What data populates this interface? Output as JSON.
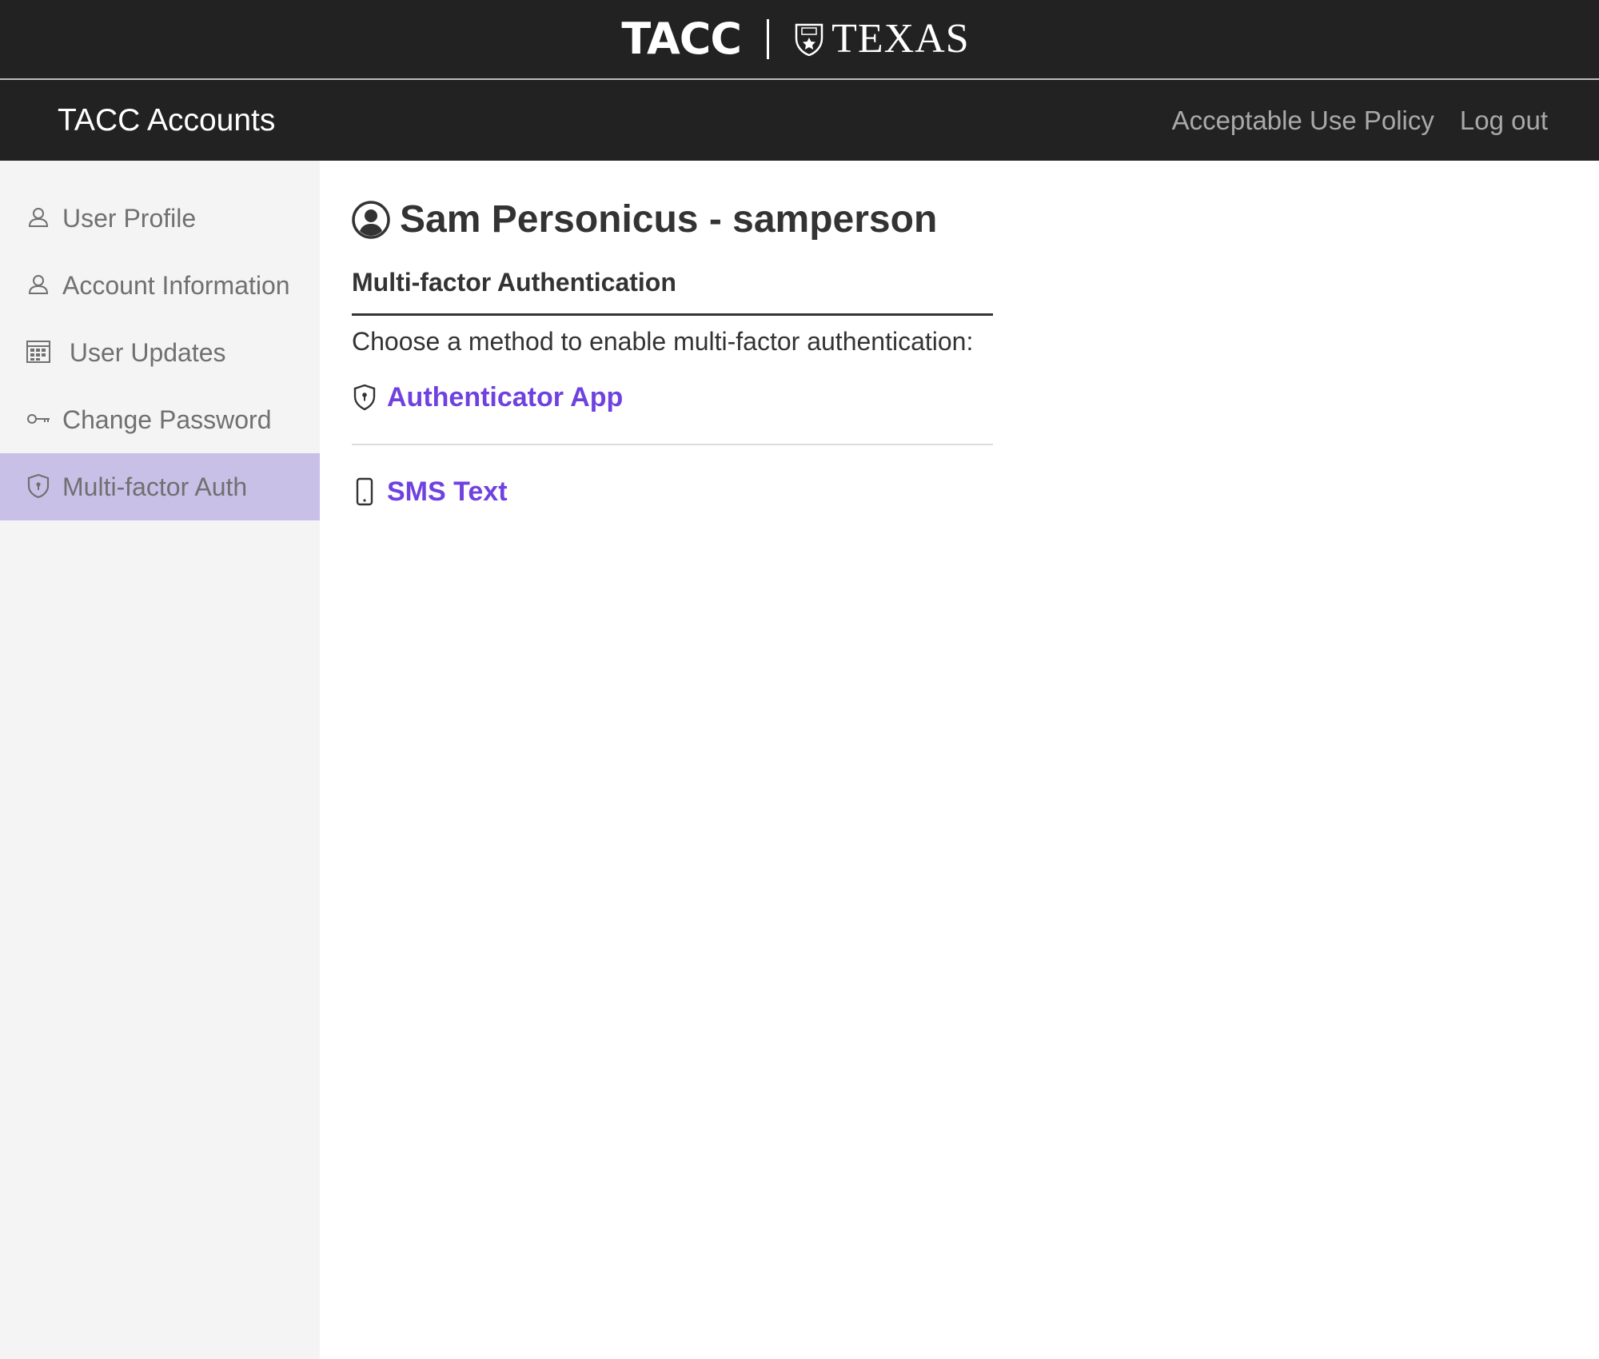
{
  "brand": {
    "tacc_logo": "TACC",
    "texas_logo": "TEXAS"
  },
  "nav": {
    "app_title": "TACC Accounts",
    "links": [
      {
        "label": "Acceptable Use Policy"
      },
      {
        "label": "Log out"
      }
    ]
  },
  "sidebar": {
    "items": [
      {
        "label": "User Profile",
        "icon": "person-icon",
        "active": false
      },
      {
        "label": "Account Information",
        "icon": "person-icon",
        "active": false
      },
      {
        "label": "User Updates",
        "icon": "calendar-icon",
        "active": false
      },
      {
        "label": "Change Password",
        "icon": "key-icon",
        "active": false
      },
      {
        "label": "Multi-factor Auth",
        "icon": "shield-icon",
        "active": true
      }
    ]
  },
  "main": {
    "user_heading": "Sam Personicus - samperson",
    "section_title": "Multi-factor Authentication",
    "section_desc": "Choose a method to enable multi-factor authentication:",
    "methods": [
      {
        "label": "Authenticator App",
        "icon": "shield-icon"
      },
      {
        "label": "SMS Text",
        "icon": "phone-icon"
      }
    ]
  },
  "colors": {
    "header_bg": "#222222",
    "sidebar_bg": "#f4f4f4",
    "active_item_bg": "#c9c0e8",
    "link_accent": "#6f42e0",
    "text_dark": "#333333",
    "nav_link": "#a9a9a9"
  }
}
